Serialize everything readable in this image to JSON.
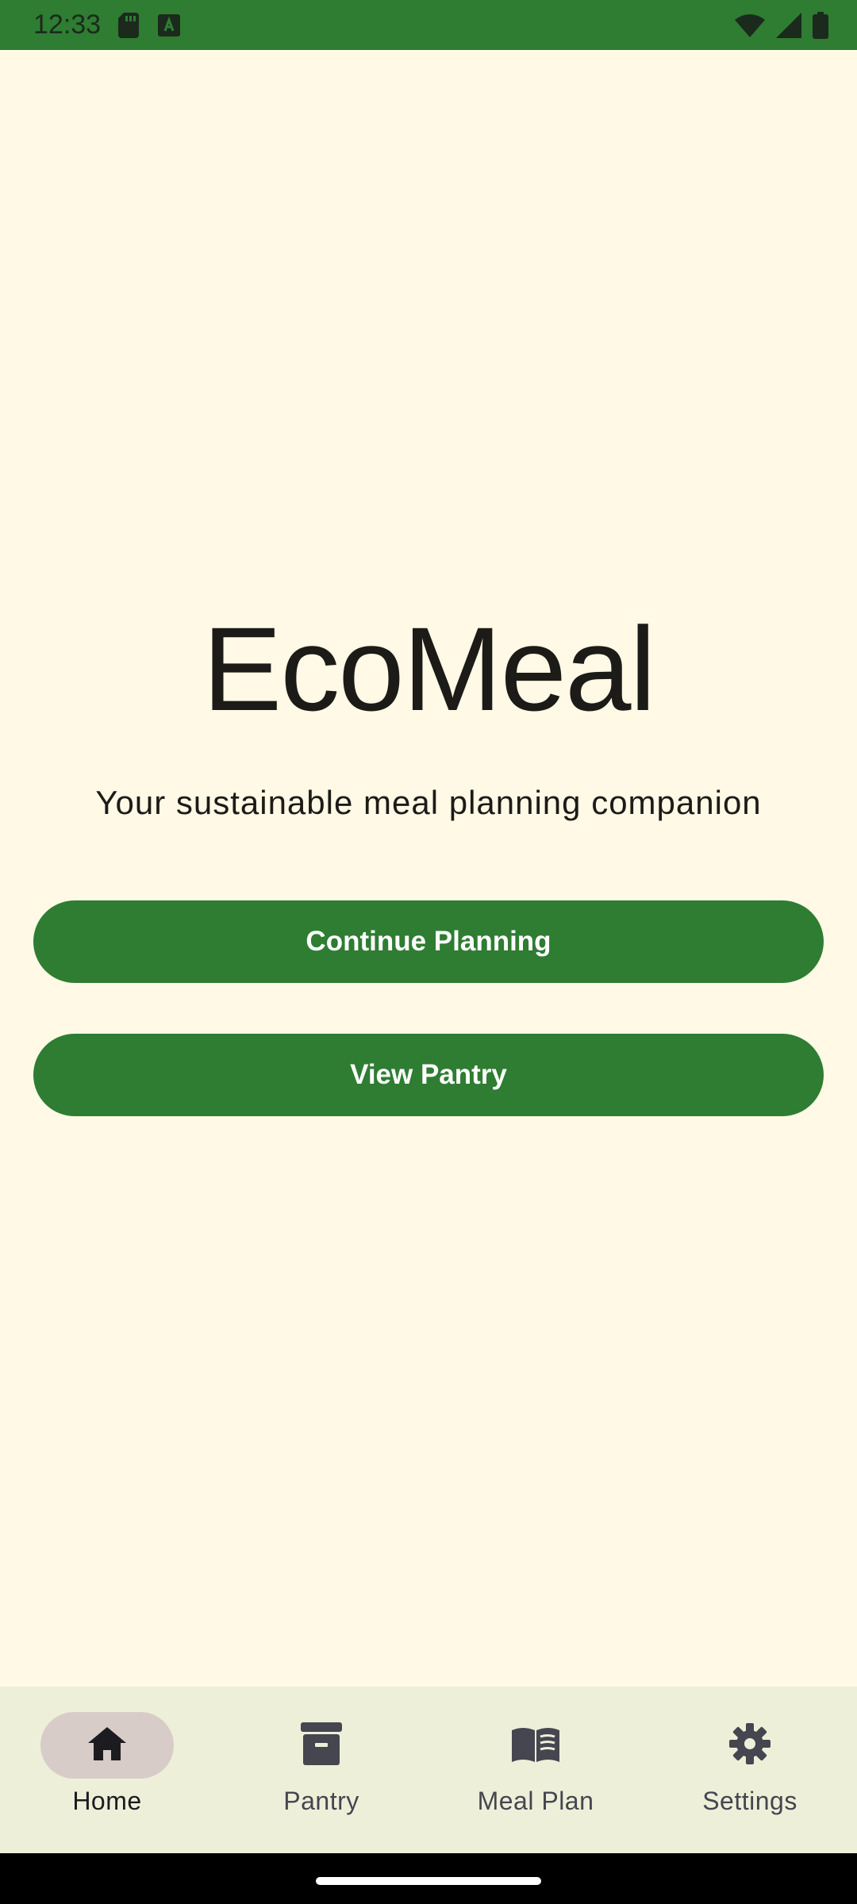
{
  "status_bar": {
    "time": "12:33",
    "icons_left": [
      "sd-card-icon",
      "text-a-icon"
    ],
    "icons_right": [
      "wifi-icon",
      "signal-icon",
      "battery-icon"
    ],
    "color": "#2E7D32"
  },
  "main": {
    "title": "EcoMeal",
    "subtitle": "Your sustainable meal planning companion",
    "buttons": {
      "continue_label": "Continue Planning",
      "pantry_label": "View Pantry"
    }
  },
  "bottom_nav": {
    "items": [
      {
        "label": "Home",
        "icon": "home-icon",
        "active": true
      },
      {
        "label": "Pantry",
        "icon": "archive-box-icon",
        "active": false
      },
      {
        "label": "Meal Plan",
        "icon": "open-book-icon",
        "active": false
      },
      {
        "label": "Settings",
        "icon": "gear-icon",
        "active": false
      }
    ]
  },
  "colors": {
    "background": "#FFF9E6",
    "accent": "#2E7D32",
    "nav_background": "#EEEFD9",
    "nav_active_pill": "#D8CCC8"
  }
}
